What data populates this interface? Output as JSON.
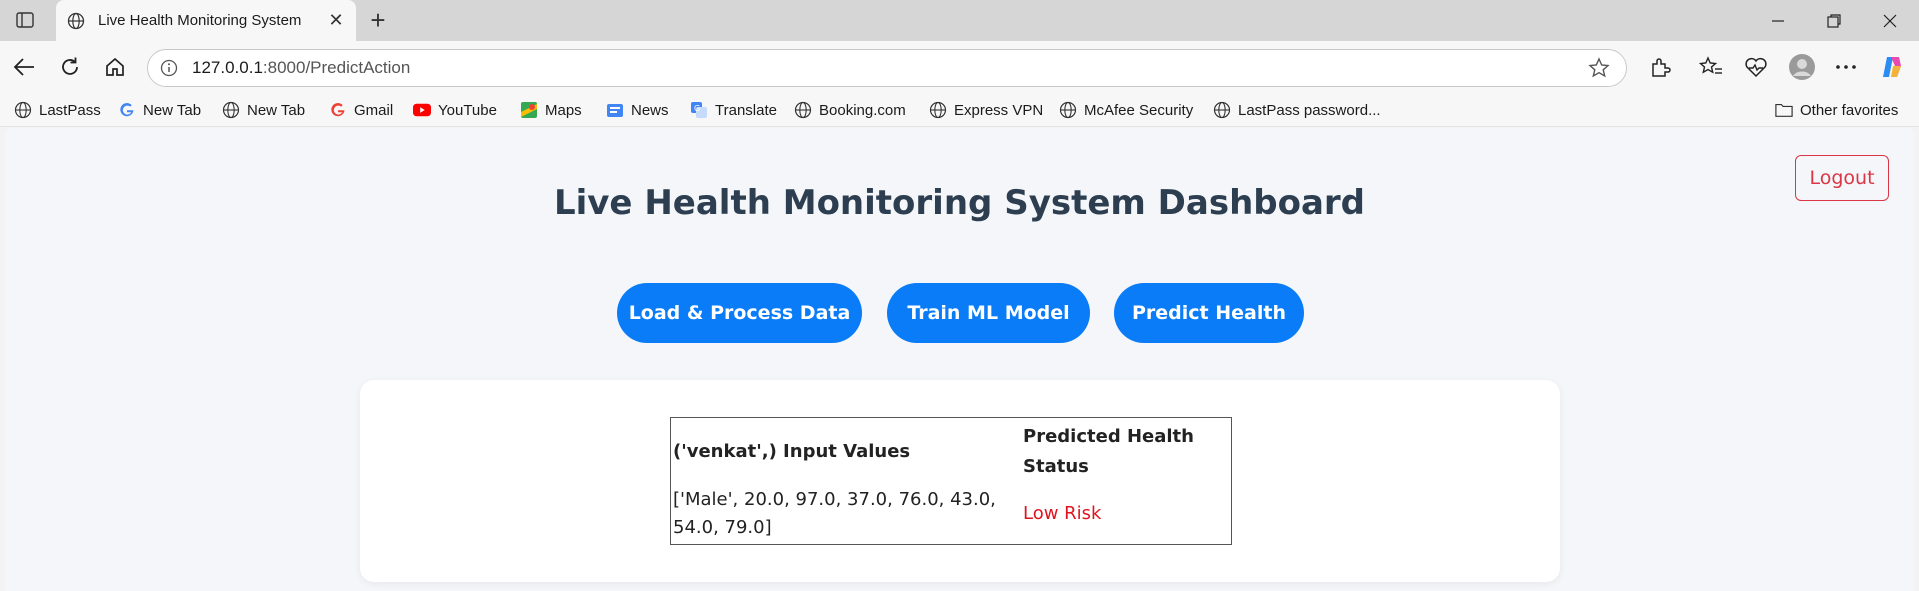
{
  "browser": {
    "tab_title": "Live Health Monitoring System",
    "url_host": "127.0.0.1",
    "url_path": ":8000/PredictAction",
    "bookmarks": [
      {
        "label": "LastPass",
        "icon": "globe-icon"
      },
      {
        "label": "New Tab",
        "icon": "google-icon"
      },
      {
        "label": "New Tab",
        "icon": "globe-icon"
      },
      {
        "label": "Gmail",
        "icon": "google-icon"
      },
      {
        "label": "YouTube",
        "icon": "youtube-icon"
      },
      {
        "label": "Maps",
        "icon": "maps-icon"
      },
      {
        "label": "News",
        "icon": "news-icon"
      },
      {
        "label": "Translate",
        "icon": "translate-icon"
      },
      {
        "label": "Booking.com",
        "icon": "globe-icon"
      },
      {
        "label": "Express VPN",
        "icon": "globe-icon"
      },
      {
        "label": "McAfee Security",
        "icon": "globe-icon"
      },
      {
        "label": "LastPass password...",
        "icon": "globe-icon"
      }
    ],
    "other_favorites": "Other favorites"
  },
  "page": {
    "logout_label": "Logout",
    "title": "Live Health Monitoring System Dashboard",
    "buttons": {
      "load": "Load & Process Data",
      "train": "Train ML Model",
      "predict": "Predict Health"
    },
    "result_table": {
      "header_input": "('venkat',) Input Values",
      "header_status": "Predicted Health Status",
      "input_values": "['Male', 20.0, 97.0, 37.0, 76.0, 43.0, 54.0, 79.0]",
      "status": "Low Risk"
    }
  },
  "colors": {
    "primary": "#0a7cf7",
    "danger": "#dc3545",
    "risk_text": "#e0141e",
    "title": "#2c3e50",
    "page_bg": "#f4f6f9"
  }
}
